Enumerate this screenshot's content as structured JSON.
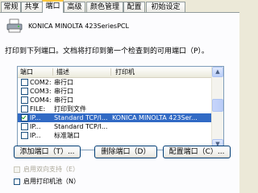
{
  "tabs": [
    "常规",
    "共享",
    "端口",
    "高级",
    "颜色管理",
    "配置",
    "初始设定"
  ],
  "active_tab": 2,
  "printer_name": "KONICA MINOLTA 423SeriesPCL",
  "description": "打印到下列端口。文档将打印到第一个检查到的可用端口（P）。",
  "list": {
    "headers": {
      "port": "端口",
      "description": "描述",
      "printer": "打印机"
    },
    "rows": [
      {
        "checked": false,
        "port": "COM2:",
        "description": "串行口",
        "printer": ""
      },
      {
        "checked": false,
        "port": "COM3:",
        "description": "串行口",
        "printer": ""
      },
      {
        "checked": false,
        "port": "COM4:",
        "description": "串行口",
        "printer": ""
      },
      {
        "checked": false,
        "port": "FILE:",
        "description": "打印到文件",
        "printer": ""
      },
      {
        "checked": true,
        "port": "IP...",
        "description": "Standard TCP/I...",
        "printer": "KONICA MINOLTA 423Ser..."
      },
      {
        "checked": false,
        "port": "IP...",
        "description": "Standard TCP/I...",
        "printer": ""
      },
      {
        "checked": false,
        "port": "IP...",
        "description": "标准端口",
        "printer": ""
      }
    ]
  },
  "buttons": {
    "add_port": "添加端口（T）...",
    "delete_port": "删除端口（D）",
    "configure_port": "配置端口（C）..."
  },
  "options": {
    "bidirectional": "启用双向支持（E）",
    "pooling": "启用打印机池（N）"
  }
}
